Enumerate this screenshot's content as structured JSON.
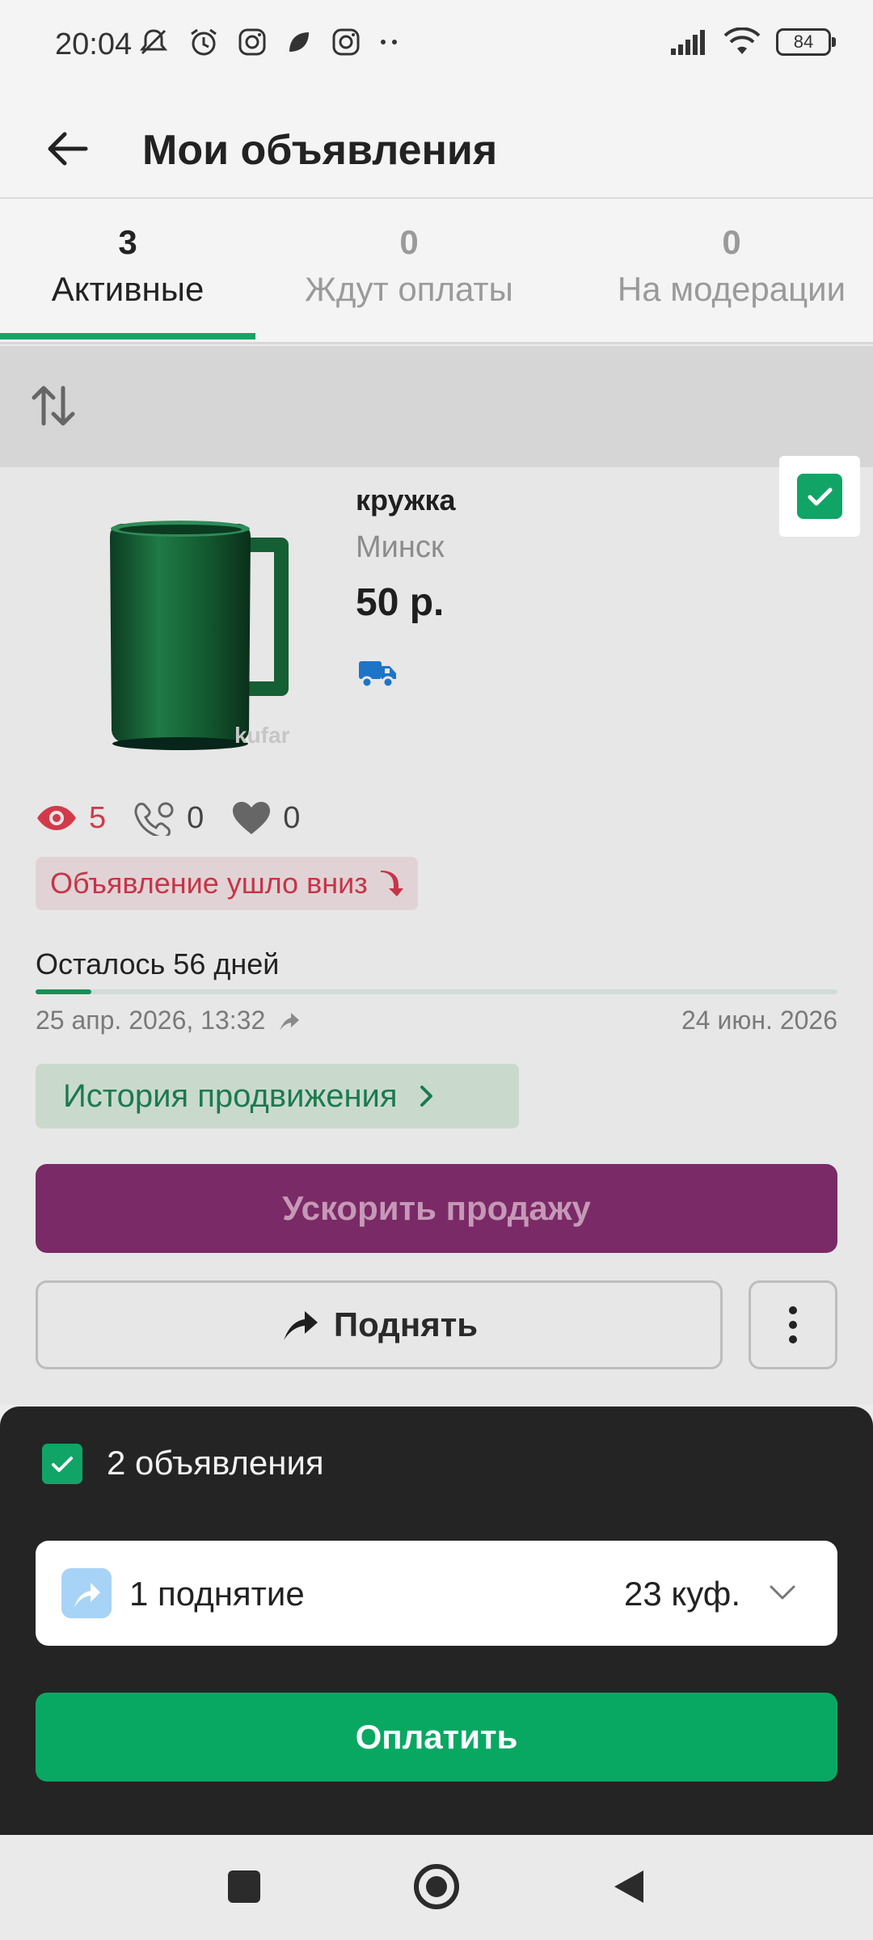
{
  "status_bar": {
    "time": "20:04",
    "battery": "84",
    "left_icons": [
      "mute-icon",
      "alarm-icon",
      "instagram-icon",
      "chat-icon",
      "instagram-icon",
      "more-dots-icon"
    ],
    "right_icons": [
      "signal-icon",
      "wifi-icon",
      "battery-icon"
    ]
  },
  "header": {
    "title": "Мои объявления"
  },
  "tabs": [
    {
      "count": "3",
      "label": "Активные",
      "active": true
    },
    {
      "count": "0",
      "label": "Ждут оплаты",
      "active": false
    },
    {
      "count": "0",
      "label": "На модерации",
      "active": false
    }
  ],
  "listing": {
    "title": "кружка",
    "city": "Минск",
    "price": "50 р.",
    "watermark": "kufar",
    "selected": true,
    "stats": {
      "views": "5",
      "calls": "0",
      "favorites": "0"
    },
    "status_badge": "Объявление ушло вниз",
    "days_left": "Осталось 56 дней",
    "progress_fraction": 0.07,
    "date_start": "25 апр. 2026, 13:32",
    "date_end": "24 июн. 2026",
    "history_label": "История продвижения",
    "speed_label": "Ускорить продажу",
    "raise_label": "Поднять"
  },
  "sheet": {
    "selected_count": "2 объявления",
    "option_qty": "1 поднятие",
    "option_price": "23 куф.",
    "pay_label": "Оплатить"
  },
  "colors": {
    "accent_green": "#09a862",
    "alert_red": "#c73448",
    "promo_purple": "#7a2a66"
  }
}
